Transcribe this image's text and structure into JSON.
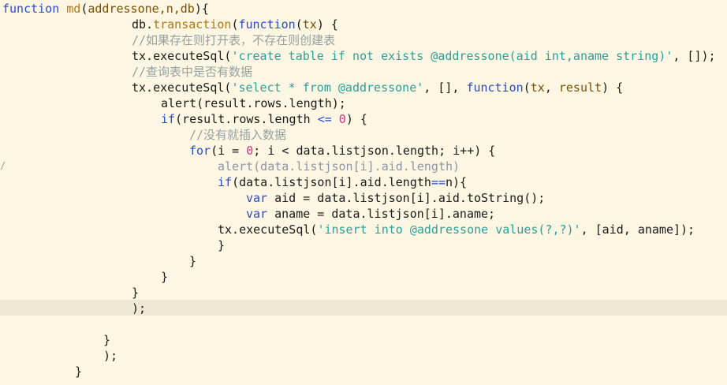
{
  "editor": {
    "background": "#fdf6e3",
    "current_line_highlight": "#eee8d5",
    "colors": {
      "keyword": "#2a4bc7",
      "function": "#b5760c",
      "string": "#2aa198",
      "number": "#d33682",
      "comment": "#93a1a1",
      "text": "#1a1a1a"
    },
    "gutter_marker": "/"
  },
  "lines": [
    {
      "indent": 3,
      "tokens": [
        [
          "kw",
          "function"
        ],
        [
          "tx",
          " "
        ],
        [
          "fn",
          "md"
        ],
        [
          "tx",
          "("
        ],
        [
          "tk",
          "addressone,n,db"
        ],
        [
          "tx",
          ")"
        ],
        [
          "tx",
          "{"
        ]
      ]
    },
    {
      "indent": 167,
      "tokens": [
        [
          "tx",
          "db."
        ],
        [
          "fn",
          "transaction"
        ],
        [
          "tx",
          "("
        ],
        [
          "kw",
          "function"
        ],
        [
          "tx",
          "("
        ],
        [
          "tk",
          "tx"
        ],
        [
          "tx",
          ") {"
        ]
      ]
    },
    {
      "indent": 167,
      "tokens": [
        [
          "cm",
          "//如果存在则打开表，不存在则创建表"
        ]
      ]
    },
    {
      "indent": 167,
      "tokens": [
        [
          "tx",
          "tx.executeSql("
        ],
        [
          "str",
          "'create table if not exists @addressone(aid int,aname string)'"
        ],
        [
          "tx",
          ", []);"
        ]
      ]
    },
    {
      "indent": 167,
      "tokens": [
        [
          "cm",
          "//查询表中是否有数据"
        ]
      ]
    },
    {
      "indent": 167,
      "tokens": [
        [
          "tx",
          "tx.executeSql("
        ],
        [
          "str",
          "'select * from @addressone'"
        ],
        [
          "tx",
          ", [], "
        ],
        [
          "kw",
          "function"
        ],
        [
          "tx",
          "("
        ],
        [
          "tk",
          "tx"
        ],
        [
          "tx",
          ", "
        ],
        [
          "tk",
          "result"
        ],
        [
          "tx",
          ") {"
        ]
      ]
    },
    {
      "indent": 204,
      "tokens": [
        [
          "tx",
          "alert(result.rows.length);"
        ]
      ]
    },
    {
      "indent": 204,
      "tokens": [
        [
          "kw",
          "if"
        ],
        [
          "tx",
          "(result.rows.length "
        ],
        [
          "kw",
          "<="
        ],
        [
          "tx",
          " "
        ],
        [
          "num",
          "0"
        ],
        [
          "tx",
          ") {"
        ]
      ]
    },
    {
      "indent": 240,
      "tokens": [
        [
          "cm",
          "//没有就插入数据"
        ]
      ]
    },
    {
      "indent": 240,
      "tokens": [
        [
          "kw",
          "for"
        ],
        [
          "tx",
          "(i = "
        ],
        [
          "num",
          "0"
        ],
        [
          "tx",
          "; i < data.listjson.length; i++) {"
        ]
      ]
    },
    {
      "indent": 276,
      "tokens": [
        [
          "gr",
          "alert(data.listjson[i].aid.length)"
        ]
      ]
    },
    {
      "indent": 276,
      "tokens": [
        [
          "kw",
          "if"
        ],
        [
          "tx",
          "(data.listjson[i].aid.length"
        ],
        [
          "kw",
          "=="
        ],
        [
          "tx",
          "n){"
        ]
      ]
    },
    {
      "indent": 312,
      "tokens": [
        [
          "kw",
          "var"
        ],
        [
          "tx",
          " aid = data.listjson[i].aid.toString();"
        ]
      ]
    },
    {
      "indent": 312,
      "tokens": [
        [
          "kw",
          "var"
        ],
        [
          "tx",
          " aname = data.listjson[i].aname;"
        ]
      ]
    },
    {
      "indent": 276,
      "tokens": [
        [
          "tx",
          "tx.executeSql("
        ],
        [
          "str",
          "'insert into @addressone values(?,?)'"
        ],
        [
          "tx",
          ", [aid, aname]);"
        ]
      ]
    },
    {
      "indent": 276,
      "tokens": [
        [
          "tx",
          "}"
        ]
      ]
    },
    {
      "indent": 240,
      "tokens": [
        [
          "tx",
          "}"
        ]
      ]
    },
    {
      "indent": 204,
      "tokens": [
        [
          "tx",
          "}"
        ]
      ]
    },
    {
      "indent": 167,
      "tokens": [
        [
          "tx",
          "}"
        ]
      ]
    },
    {
      "indent": 167,
      "tokens": [
        [
          "tx",
          ");"
        ]
      ]
    },
    {
      "indent": 0,
      "tokens": []
    },
    {
      "indent": 131,
      "tokens": [
        [
          "tx",
          "}"
        ]
      ]
    },
    {
      "indent": 131,
      "tokens": [
        [
          "tx",
          ");"
        ]
      ]
    },
    {
      "indent": 95,
      "tokens": [
        [
          "tx",
          "}"
        ]
      ]
    }
  ]
}
